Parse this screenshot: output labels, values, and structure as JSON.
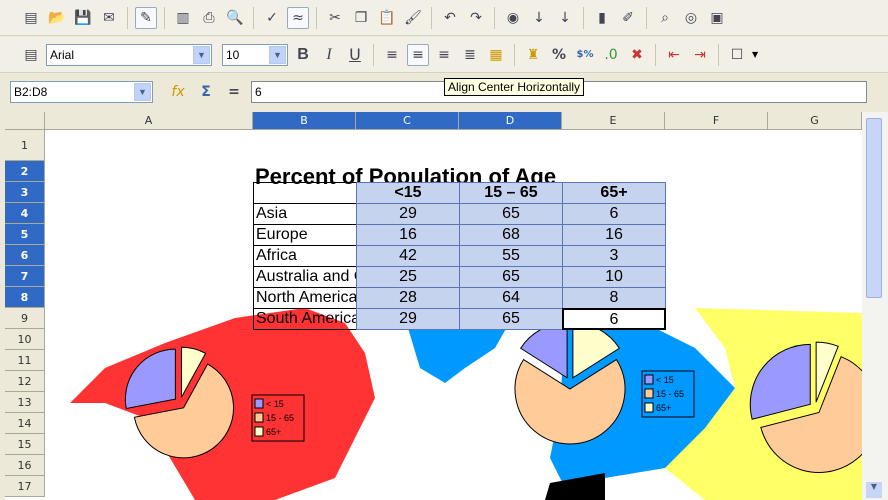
{
  "toolbar1": {
    "icons": [
      "new-icon",
      "open-icon",
      "save-icon",
      "email-icon",
      "edit-file-icon",
      "export-pdf-icon",
      "print-icon",
      "page-preview-icon",
      "spellcheck-icon",
      "autospellcheck-icon",
      "cut-icon",
      "copy-icon",
      "paste-icon",
      "format-paintbrush-icon",
      "undo-icon",
      "redo-icon",
      "navigator-icon",
      "sort-ascending-icon",
      "sort-descending-icon",
      "chart-icon",
      "draw-functions-icon",
      "find-icon",
      "gallery-icon",
      "image-icon"
    ]
  },
  "toolbar2": {
    "font_name": "Arial",
    "font_size": "10",
    "bold": "B",
    "italic": "I",
    "underline": "U",
    "percent": "%",
    "currency": "$%"
  },
  "formula_bar": {
    "cell_ref": "B2:D8",
    "equals": "=",
    "value": "6"
  },
  "tooltip": "Align Center Horizontally",
  "columns": [
    "A",
    "B",
    "C",
    "D",
    "E",
    "F",
    "G"
  ],
  "rows": [
    "1",
    "2",
    "3",
    "4",
    "5",
    "6",
    "7",
    "8",
    "9",
    "10",
    "11",
    "12",
    "13",
    "14",
    "15",
    "16",
    "17"
  ],
  "sheet": {
    "title": "Percent of Population of Age",
    "headers": [
      "<15",
      "15 – 65",
      "65+"
    ],
    "data": [
      {
        "region": "Asia",
        "values": [
          "29",
          "65",
          "6"
        ]
      },
      {
        "region": "Europe",
        "values": [
          "16",
          "68",
          "16"
        ]
      },
      {
        "region": "Africa",
        "values": [
          "42",
          "55",
          "3"
        ]
      },
      {
        "region": "Australia and Oceania",
        "values": [
          "25",
          "65",
          "10"
        ]
      },
      {
        "region": "North America",
        "values": [
          "28",
          "64",
          "8"
        ]
      },
      {
        "region": "South America",
        "values": [
          "29",
          "65",
          "6"
        ]
      }
    ]
  },
  "legend": [
    "< 15",
    "15 - 65",
    "65+"
  ],
  "colors": {
    "under15": "#9999ff",
    "mid": "#ffcc99",
    "over65": "#ffffcc",
    "na": "#ff3333",
    "europe": "#0099ff",
    "asia": "#ffff66"
  }
}
